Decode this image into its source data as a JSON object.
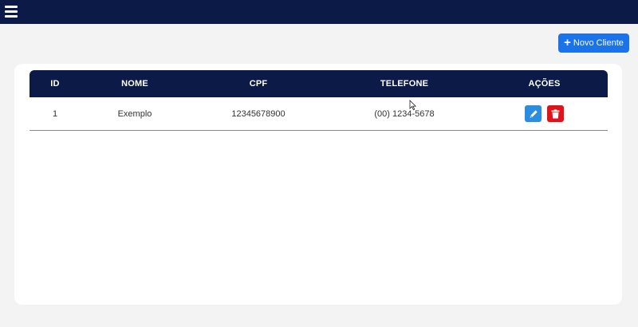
{
  "app": {
    "menu_icon": "hamburger-menu-icon",
    "colors": {
      "navbar": "#0b1a47",
      "primary": "#1a73e8",
      "danger": "#e0121b",
      "edit": "#2a8de0"
    }
  },
  "toolbar": {
    "new_client_label": "Novo Cliente",
    "new_client_icon": "plus-icon"
  },
  "table": {
    "columns": [
      "ID",
      "NOME",
      "CPF",
      "TELEFONE",
      "AÇÕES"
    ],
    "rows": [
      {
        "id": "1",
        "nome": "Exemplo",
        "cpf": "12345678900",
        "telefone": "(00) 1234-5678",
        "actions": [
          "pencil-icon",
          "trash-icon"
        ]
      }
    ]
  }
}
